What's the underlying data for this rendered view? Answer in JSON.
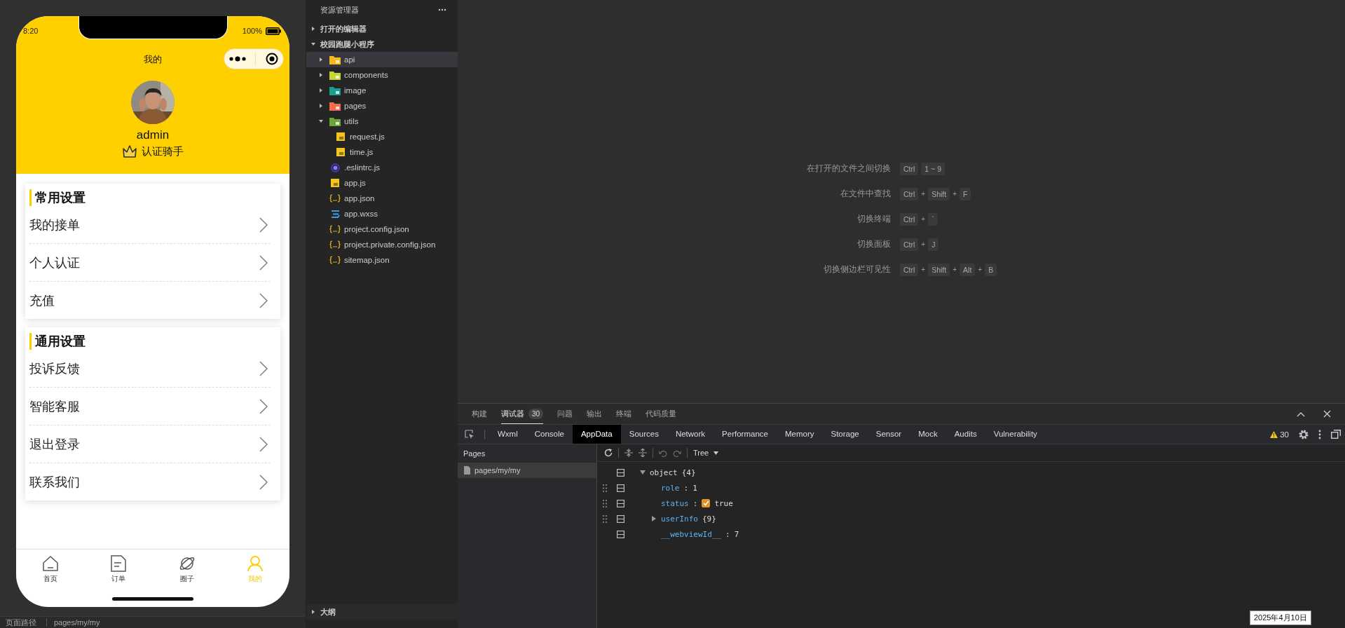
{
  "simulator": {
    "status_bar": {
      "time": "8:20",
      "battery": "100%"
    },
    "nav_title": "我的",
    "profile": {
      "username": "admin",
      "badge": "认证骑手"
    },
    "sections": [
      {
        "title": "常用设置",
        "items": [
          "我的接单",
          "个人认证",
          "充值"
        ]
      },
      {
        "title": "通用设置",
        "items": [
          "投诉反馈",
          "智能客服",
          "退出登录",
          "联系我们"
        ]
      }
    ],
    "tab_bar": [
      {
        "label": "首页",
        "kind": "home",
        "selected": false
      },
      {
        "label": "订单",
        "kind": "order",
        "selected": false
      },
      {
        "label": "圈子",
        "kind": "planet",
        "selected": false
      },
      {
        "label": "我的",
        "kind": "person",
        "selected": true
      }
    ],
    "footer": {
      "path_label": "页面路径",
      "path": "pages/my/my"
    }
  },
  "explorer": {
    "title": "资源管理器",
    "sections": [
      {
        "label": "打开的编辑器",
        "expanded": false
      },
      {
        "label": "校园跑腿小程序",
        "expanded": true
      }
    ],
    "tree": [
      {
        "name": "api",
        "kind": "folder",
        "color": "#f5b922",
        "expanded": false,
        "selected": true
      },
      {
        "name": "components",
        "kind": "folder",
        "color": "#c5d535",
        "expanded": false,
        "selected": false
      },
      {
        "name": "image",
        "kind": "folder",
        "color": "#1b9e8a",
        "expanded": false,
        "selected": false
      },
      {
        "name": "pages",
        "kind": "folder",
        "color": "#f26b4f",
        "expanded": false,
        "selected": false
      },
      {
        "name": "utils",
        "kind": "folder",
        "color": "#6ea53a",
        "expanded": true,
        "selected": false,
        "children": [
          {
            "name": "request.js",
            "kind": "js",
            "selected": false
          },
          {
            "name": "time.js",
            "kind": "js",
            "selected": false
          }
        ]
      },
      {
        "name": ".eslintrc.js",
        "kind": "eslint",
        "selected": false
      },
      {
        "name": "app.js",
        "kind": "js",
        "selected": false
      },
      {
        "name": "app.json",
        "kind": "json",
        "selected": false
      },
      {
        "name": "app.wxss",
        "kind": "css",
        "selected": false
      },
      {
        "name": "project.config.json",
        "kind": "json",
        "selected": false
      },
      {
        "name": "project.private.config.json",
        "kind": "json",
        "selected": false
      },
      {
        "name": "sitemap.json",
        "kind": "json",
        "selected": false
      }
    ],
    "outline": {
      "label": "大纲",
      "expanded": false
    }
  },
  "editor_hints": [
    {
      "label": "在打开的文件之间切换",
      "keys": [
        {
          "kind": "key",
          "text": "Ctrl"
        },
        {
          "kind": "key",
          "text": "1 ~ 9"
        }
      ]
    },
    {
      "label": "在文件中查找",
      "keys": [
        {
          "kind": "key",
          "text": "Ctrl"
        },
        {
          "kind": "plus",
          "text": "+"
        },
        {
          "kind": "key",
          "text": "Shift"
        },
        {
          "kind": "plus",
          "text": "+"
        },
        {
          "kind": "key",
          "text": "F"
        }
      ]
    },
    {
      "label": "切换终端",
      "keys": [
        {
          "kind": "key",
          "text": "Ctrl"
        },
        {
          "kind": "plus",
          "text": "+"
        },
        {
          "kind": "key",
          "text": "`"
        }
      ]
    },
    {
      "label": "切换面板",
      "keys": [
        {
          "kind": "key",
          "text": "Ctrl"
        },
        {
          "kind": "plus",
          "text": "+"
        },
        {
          "kind": "key",
          "text": "J"
        }
      ]
    },
    {
      "label": "切换侧边栏可见性",
      "keys": [
        {
          "kind": "key",
          "text": "Ctrl"
        },
        {
          "kind": "plus",
          "text": "+"
        },
        {
          "kind": "key",
          "text": "Shift"
        },
        {
          "kind": "plus",
          "text": "+"
        },
        {
          "kind": "key",
          "text": "Alt"
        },
        {
          "kind": "plus",
          "text": "+"
        },
        {
          "kind": "key",
          "text": "B"
        }
      ]
    }
  ],
  "panel": {
    "tabs": [
      {
        "label": "构建",
        "selected": false
      },
      {
        "label": "调试器",
        "selected": true,
        "badge": "30"
      },
      {
        "label": "问题",
        "selected": false
      },
      {
        "label": "输出",
        "selected": false
      },
      {
        "label": "终端",
        "selected": false
      },
      {
        "label": "代码质量",
        "selected": false
      }
    ],
    "devtools_tabs": [
      {
        "label": "Wxml",
        "selected": false
      },
      {
        "label": "Console",
        "selected": false
      },
      {
        "label": "AppData",
        "selected": true
      },
      {
        "label": "Sources",
        "selected": false
      },
      {
        "label": "Network",
        "selected": false
      },
      {
        "label": "Performance",
        "selected": false
      },
      {
        "label": "Memory",
        "selected": false
      },
      {
        "label": "Storage",
        "selected": false
      },
      {
        "label": "Sensor",
        "selected": false
      },
      {
        "label": "Mock",
        "selected": false
      },
      {
        "label": "Audits",
        "selected": false
      },
      {
        "label": "Vulnerability",
        "selected": false
      }
    ],
    "warnings": "30",
    "pages": {
      "title": "Pages",
      "items": [
        {
          "label": "pages/my/my",
          "selected": true
        }
      ]
    },
    "view_mode": "Tree",
    "separator": ":",
    "data_tree": [
      {
        "key": "object",
        "value": "{4}",
        "kind": "object",
        "expanded": true,
        "draggable": false,
        "children": [
          {
            "key": "role",
            "value": "1",
            "kind": "value",
            "draggable": true
          },
          {
            "key": "status",
            "value": "true",
            "kind": "checkbox",
            "checked": true,
            "draggable": true
          },
          {
            "key": "userInfo",
            "value": "{9}",
            "kind": "object",
            "expanded": false,
            "draggable": true
          },
          {
            "key": "__webviewId__",
            "value": "7",
            "kind": "value",
            "draggable": false
          }
        ]
      }
    ]
  },
  "tooltip": {
    "text": "2025年4月10日"
  }
}
